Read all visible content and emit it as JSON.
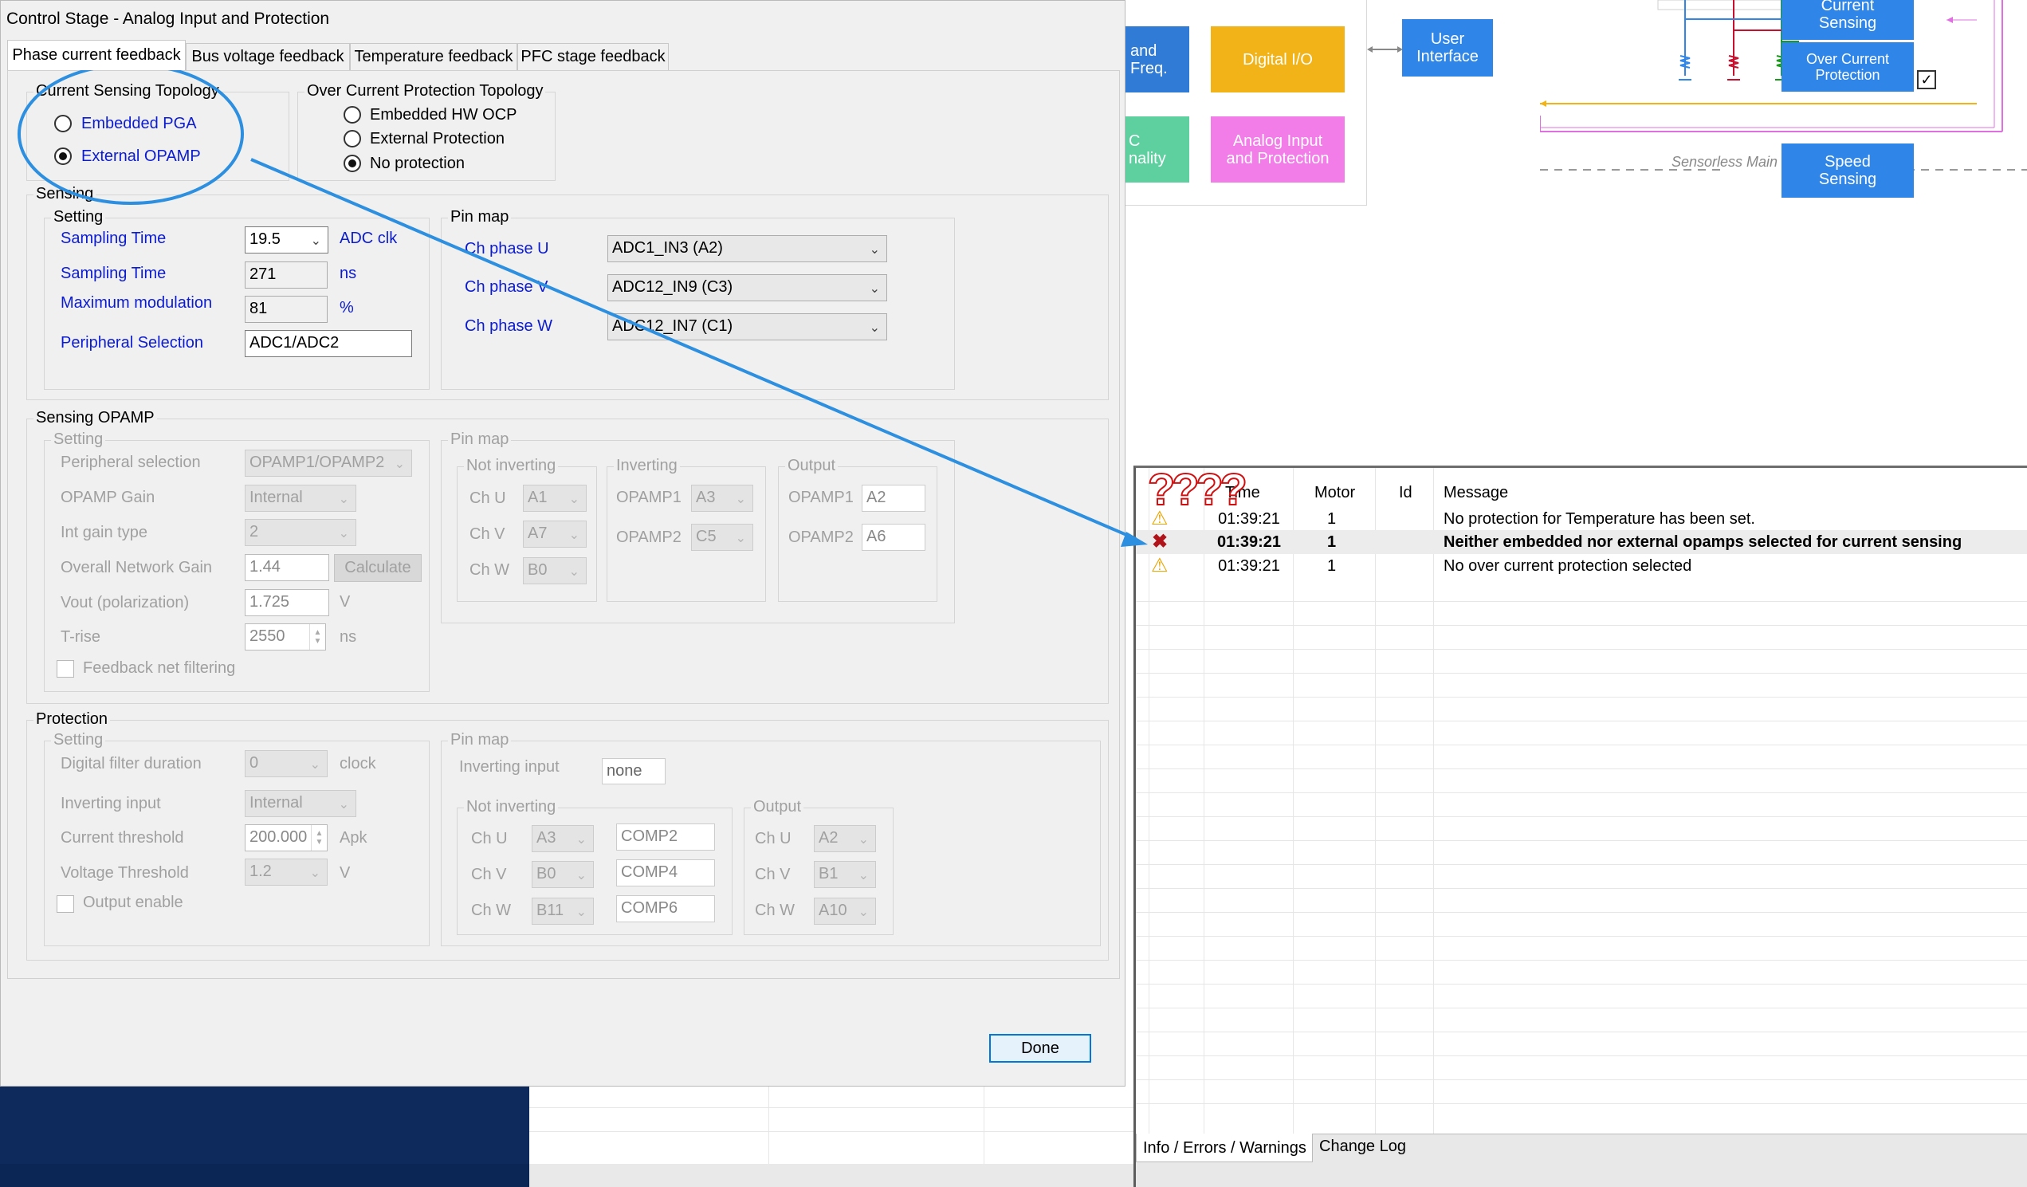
{
  "dialog": {
    "title": "Control Stage - Analog Input and Protection",
    "tabs": [
      "Phase current feedback",
      "Bus voltage feedback",
      "Temperature feedback",
      "PFC stage feedback"
    ],
    "done_label": "Done"
  },
  "current_sensing_topology": {
    "caption": "Current Sensing Topology",
    "options": [
      "Embedded PGA",
      "External OPAMP"
    ],
    "selected": "External OPAMP"
  },
  "ocp_topology": {
    "caption": "Over Current Protection Topology",
    "options": [
      "Embedded HW OCP",
      "External Protection",
      "No protection"
    ],
    "selected": "No protection"
  },
  "sensing": {
    "caption": "Sensing",
    "setting_caption": "Setting",
    "sampling_time_label": "Sampling Time",
    "sampling_time_value": "19.5",
    "sampling_time_unit": "ADC clk",
    "sampling_time2_label": "Sampling Time",
    "sampling_time2_value": "271",
    "sampling_time2_unit": "ns",
    "max_mod_label": "Maximum modulation",
    "max_mod_value": "81",
    "max_mod_unit": "%",
    "peripheral_label": "Peripheral Selection",
    "peripheral_value": "ADC1/ADC2",
    "pinmap_caption": "Pin map",
    "pins": [
      {
        "label": "Ch phase U",
        "value": "ADC1_IN3 (A2)"
      },
      {
        "label": "Ch phase V",
        "value": "ADC12_IN9 (C3)"
      },
      {
        "label": "Ch phase W",
        "value": "ADC12_IN7 (C1)"
      }
    ]
  },
  "sensing_opamp": {
    "caption": "Sensing OPAMP",
    "setting_caption": "Setting",
    "peripheral_label": "Peripheral selection",
    "peripheral_value": "OPAMP1/OPAMP2",
    "gain_label": "OPAMP Gain",
    "gain_value": "Internal",
    "int_gain_label": "Int gain type",
    "int_gain_value": "2",
    "net_gain_label": "Overall Network Gain",
    "net_gain_value": "1.44",
    "calculate_label": "Calculate",
    "vout_label": "Vout (polarization)",
    "vout_value": "1.725",
    "vout_unit": "V",
    "trise_label": "T-rise",
    "trise_value": "2550",
    "trise_unit": "ns",
    "filter_label": "Feedback net filtering",
    "pinmap_caption": "Pin map",
    "not_inverting_caption": "Not inverting",
    "inverting_caption": "Inverting",
    "output_caption": "Output",
    "not_inverting": [
      {
        "label": "Ch U",
        "value": "A1"
      },
      {
        "label": "Ch V",
        "value": "A7"
      },
      {
        "label": "Ch W",
        "value": "B0"
      }
    ],
    "inverting": [
      {
        "label": "OPAMP1",
        "value": "A3"
      },
      {
        "label": "OPAMP2",
        "value": "C5"
      }
    ],
    "output": [
      {
        "label": "OPAMP1",
        "value": "A2"
      },
      {
        "label": "OPAMP2",
        "value": "A6"
      }
    ]
  },
  "protection": {
    "caption": "Protection",
    "setting_caption": "Setting",
    "filter_label": "Digital filter duration",
    "filter_value": "0",
    "filter_unit": "clock",
    "inv_input_label": "Inverting input",
    "inv_input_value": "Internal",
    "cur_thr_label": "Current threshold",
    "cur_thr_value": "200.000",
    "cur_thr_unit": "Apk",
    "volt_thr_label": "Voltage Threshold",
    "volt_thr_value": "1.2",
    "volt_thr_unit": "V",
    "output_enable_label": "Output enable",
    "pinmap_caption": "Pin map",
    "inv_pin_label": "Inverting input",
    "inv_pin_value": "none",
    "not_inverting_caption": "Not inverting",
    "output_caption": "Output",
    "not_inverting": [
      {
        "label": "Ch U",
        "value": "A3",
        "comp": "COMP2"
      },
      {
        "label": "Ch V",
        "value": "B0",
        "comp": "COMP4"
      },
      {
        "label": "Ch W",
        "value": "B11",
        "comp": "COMP6"
      }
    ],
    "output": [
      {
        "label": "Ch U",
        "value": "A2"
      },
      {
        "label": "Ch V",
        "value": "B1"
      },
      {
        "label": "Ch W",
        "value": "A10"
      }
    ]
  },
  "diagram": {
    "blocks": [
      {
        "label": "and Freq.",
        "color": "#2f7bd6"
      },
      {
        "label": "Digital I/O",
        "color": "#f2b319"
      },
      {
        "label": "User Interface",
        "color": "#2f86e8"
      },
      {
        "label": "Current Sensing",
        "color": "#2f86e8"
      },
      {
        "label": "Over Current Protection",
        "color": "#2f86e8"
      },
      {
        "label": "C nality",
        "color": "#5ed0a0"
      },
      {
        "label": "Analog Input and Protection",
        "color": "#f27de8"
      },
      {
        "label": "Speed Sensing",
        "color": "#2f86e8"
      }
    ],
    "dashed_label": "Sensorless Main"
  },
  "log": {
    "overlay": "????",
    "headers": [
      "Time",
      "Motor",
      "Id",
      "Message"
    ],
    "rows": [
      {
        "icon": "warning",
        "time": "01:39:21",
        "motor": "1",
        "message": "No protection for Temperature has been set."
      },
      {
        "icon": "error",
        "time": "01:39:21",
        "motor": "1",
        "message": "Neither embedded nor external opamps selected for current sensing"
      },
      {
        "icon": "warning",
        "time": "01:39:21",
        "motor": "1",
        "message": "No over current protection selected"
      }
    ],
    "tabs": [
      "Info / Errors / Warnings",
      "Change Log"
    ]
  },
  "colors": {
    "annotation": "#2d8fe0",
    "label_blue": "#0b1bd1",
    "navy": "#0e2a5c"
  }
}
